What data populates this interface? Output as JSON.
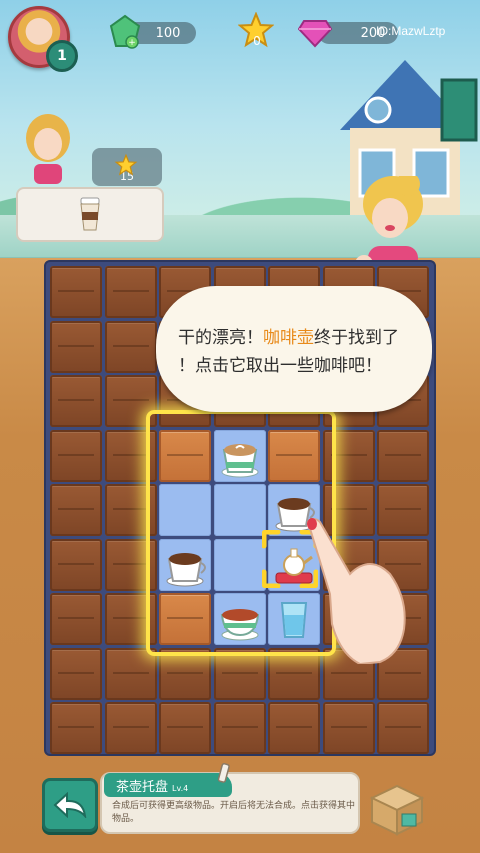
{
  "hud": {
    "level": "1",
    "green_gems": "100",
    "stars": "0",
    "pink_gems": "200",
    "player_id": "ID:MazwLztp"
  },
  "order": {
    "star_reward": "15",
    "item_icon": "coffee-cup-icon"
  },
  "bubble": {
    "line1_pre": "干的漂亮！",
    "line1_highlight": "咖啡壶",
    "line1_post": "终于找到了",
    "line2": "！点击它取出一些咖啡吧！"
  },
  "info": {
    "item_name": "茶壶托盘",
    "item_level": "Lv.4",
    "description": "合成后可获得更高级物品。开启后将无法合成。点击获得其中物品。"
  },
  "colors": {
    "accent_green": "#2e9e86",
    "highlight_yellow": "#ffe44a",
    "text_highlight": "#e88a1a"
  }
}
